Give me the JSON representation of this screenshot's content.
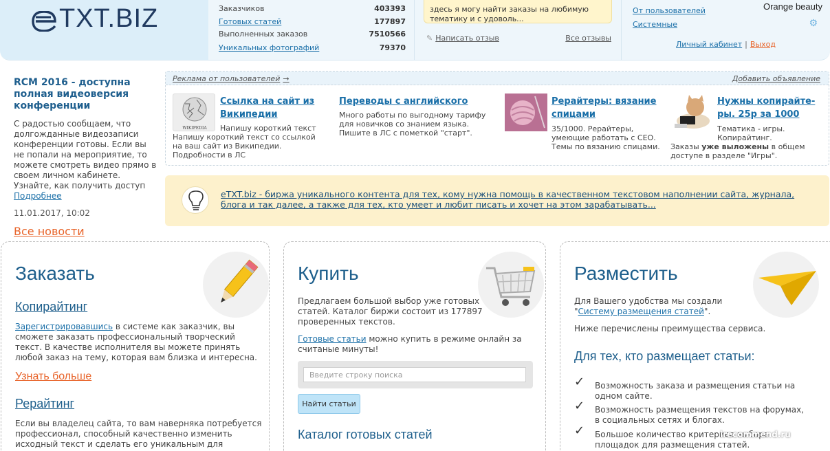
{
  "header": {
    "logo": "eTXT.BIZ",
    "stats": [
      {
        "label": "Заказчиков",
        "value": "403393",
        "link": false
      },
      {
        "label": "Готовых статей",
        "value": "177897",
        "link": true
      },
      {
        "label": "Выполненных заказов",
        "value": "7510566",
        "link": false
      },
      {
        "label": "Уникальных фотографий",
        "value": "79370",
        "link": true
      }
    ],
    "review_text": "здесь я могу найти заказы на любимую тематику и с удоволь...",
    "write_review": "Написать отзыв",
    "all_reviews": "Все отзывы",
    "from_users": "От пользователей",
    "system": "Системные",
    "username": "Orange beauty",
    "cabinet": "Личный кабинет",
    "separator": "|",
    "logout": "Выход"
  },
  "news": {
    "title": "RCM 2016 - доступна полная видеоверсия конференции",
    "text": "С радостью сообщаем, что долгожданные видеозаписи конференции готовы. Если вы не попали на мероприятие, то можете смотреть видео прямо в своем личном кабинете. Узнайте, как получить доступ",
    "more": "Подробнее",
    "date": "11.01.2017, 10:02",
    "all_news": "Все новости"
  },
  "ads": {
    "header": "Реклама от пользователей",
    "arrow": "→",
    "add": "Добавить объявление",
    "items": [
      {
        "title_1": "Ссылка на сайт из",
        "title_2": "Википедии",
        "text": "Напишу короткий текст со ссылкой на ваш сайт из Википедии. Подробности в ЛС",
        "img_label": "WIKIPEDIA"
      },
      {
        "title_1": "Переводы с английского",
        "title_2": "",
        "text": "Много работы по выгодному тарифу для новичков со знанием языка. Пишите в ЛС с пометкой \"старт\"."
      },
      {
        "title_1": "Рерайтеры: вязание",
        "title_2": "спицами",
        "text": "35/1000. Рерайтеры, умеющие работать с СЕО. Темы по вязанию спицами."
      },
      {
        "title_1": "Нужны копирайте-",
        "title_2": "ры. 25р за 1000",
        "text_a": "Тематика - игры. Копирайтинг.",
        "text_b_1": "Заказы ",
        "text_b_bold": "уже выложены",
        "text_b_2": " в общем доступе в разделе \"Игры\"."
      }
    ]
  },
  "banner": {
    "text": "eTXT.biz - биржа уникального контента для тех, кому нужна помощь в качественном текстовом наполнении сайта, журнала, блога и так далее, а также для тех, кто умеет и любит писать и хочет на этом зарабатывать..."
  },
  "order": {
    "title": "Заказать",
    "copy_title": "Копирайтинг",
    "copy_link": "Зарегистрировавшись",
    "copy_text": " в системе как заказчик, вы сможете заказать профессиональный творческий текст. В качестве исполнителя вы можете принять любой заказ на тему, которая вам близка и интересна.",
    "learn_more": "Узнать больше",
    "rewrite_title": "Рерайтинг",
    "rewrite_text": "Если вы владелец сайта, то вам наверняка потребуется профессионал, способный качественно изменить исходный текст и сделать его уникальным для"
  },
  "buy": {
    "title": "Купить",
    "text": "Предлагаем большой выбор уже готовых статей. Каталог биржи состоит из 177897 проверенных текстов.",
    "ready_link": "Готовые статьи",
    "ready_text": " можно купить в режиме онлайн за считаные минуты!",
    "search_placeholder": "Введите строку поиска",
    "search_button": "Найти статьи",
    "catalog_title": "Каталог готовых статей"
  },
  "place": {
    "title": "Разместить",
    "text_1": "Для Вашего удобства мы создали",
    "text_quote_open": "\"",
    "text_link": "Систему размещения статей",
    "text_quote_close": "\".",
    "text_2": "Ниже перечислены преимущества сервиса.",
    "subtitle": "Для тех, кто размещает статьи:",
    "check": "✓",
    "benefits": [
      "Возможность заказа и размещения статьи на одном сайте.",
      "Возможность размещения текстов на форумах, в социальных сетях и блогах.",
      "Большое количество критериев выбора площадок для размещения статей."
    ]
  },
  "watermark": "irecommend.ru"
}
